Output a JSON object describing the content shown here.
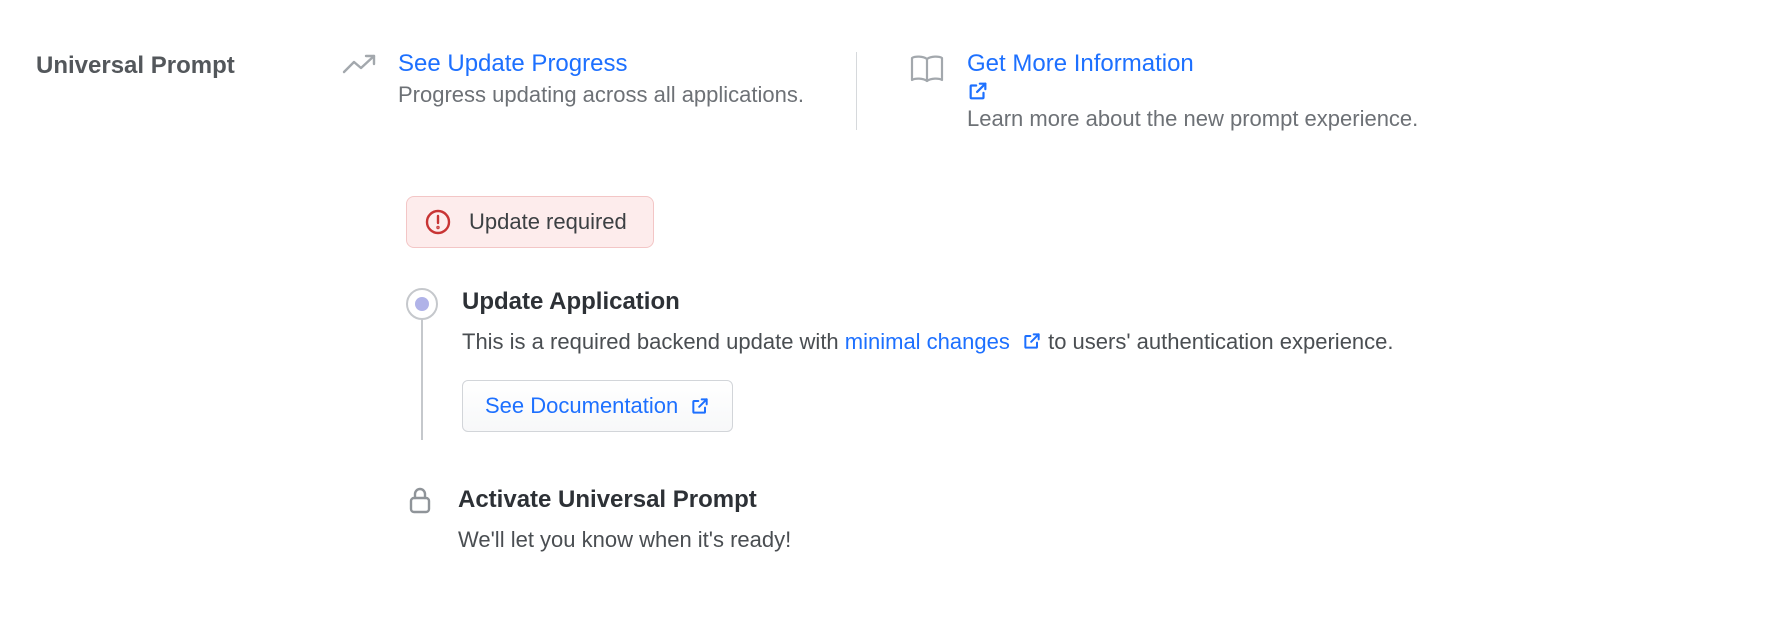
{
  "label": "Universal Prompt",
  "info": {
    "progress": {
      "title": "See Update Progress",
      "desc": "Progress updating across all applications."
    },
    "more": {
      "title": "Get More Information",
      "desc": "Learn more about the new prompt experience."
    }
  },
  "alert": {
    "text": "Update required"
  },
  "steps": {
    "update": {
      "title": "Update Application",
      "desc_before": "This is a required backend update with ",
      "link_text": "minimal changes",
      "desc_after": " to users' authentication experience.",
      "button": "See Documentation"
    },
    "activate": {
      "title": "Activate Universal Prompt",
      "desc": "We'll let you know when it's ready!"
    }
  }
}
